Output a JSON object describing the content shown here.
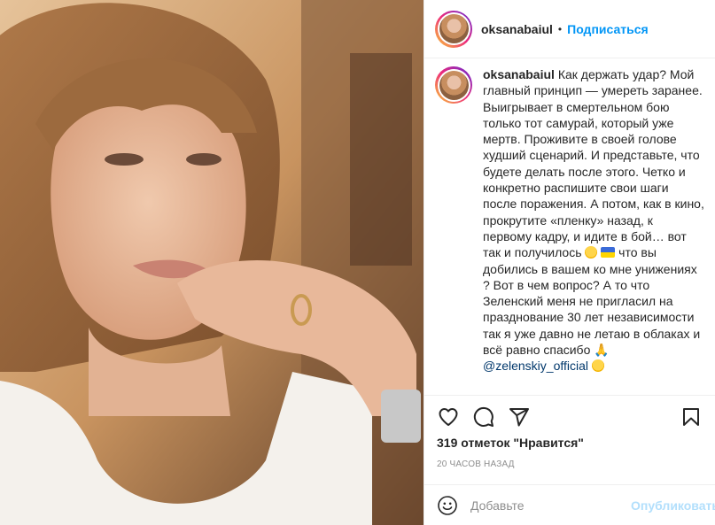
{
  "post": {
    "username": "oksanabaiul",
    "follow_label": "Подписаться",
    "separator": "•",
    "caption": {
      "username": "oksanabaiul",
      "text_part1": "Как держать удар? Мой главный принцип — умереть заранее. Выигрывает в смертельном бою только тот самурай, который уже мертв. Проживите в своей голове худший сценарий. И представьте, что будете делать после этого. Четко и конкретно распишите свои шаги после поражения. А потом, как в кино, прокрутите «пленку» назад, к первому кадру, и идите в бой… вот так и получилось ",
      "text_part2": " что вы добились в вашем ко мне унижениях ? Вот в чем вопрос? А то что Зеленский меня не пригласил на празднование 30 лет независимости так я уже давно не летаю в облаках и всё равно спасибо ",
      "mention": "@zelenskiy_official",
      "emojis": [
        "grinning-face",
        "ukraine-flag",
        "folded-hands",
        "rofl-face"
      ]
    },
    "likes_text": "319 отметок \"Нравится\"",
    "timestamp": "20 часов назад",
    "comment": {
      "placeholder": "Добавьте",
      "publish_label": "Опубликовать"
    }
  },
  "icons": {
    "like": "heart-icon",
    "comment": "comment-icon",
    "share": "share-icon",
    "save": "bookmark-icon",
    "emoji": "emoji-icon"
  },
  "colors": {
    "accent": "#0095f6",
    "publish_disabled": "#b2dffc",
    "mention": "#00376b",
    "muted": "#8e8e8e",
    "text": "#262626",
    "border": "#efefef"
  }
}
